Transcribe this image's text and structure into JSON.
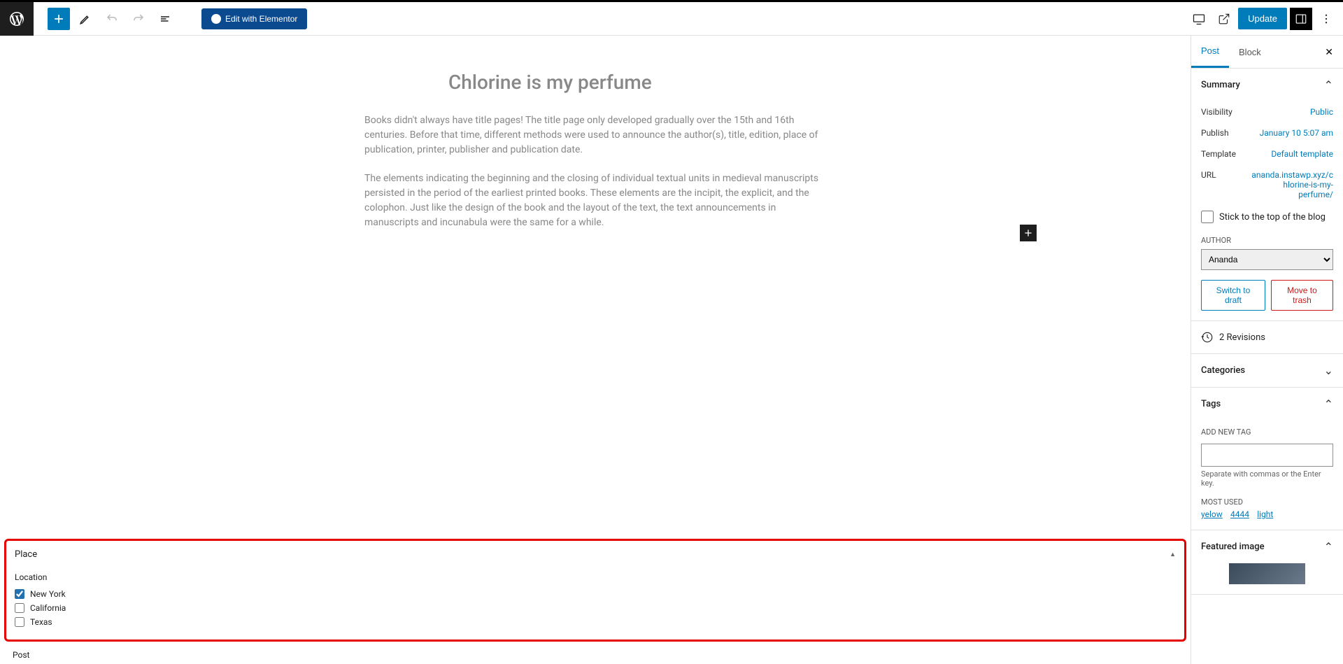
{
  "toolbar": {
    "elementor": "Edit with Elementor",
    "update": "Update"
  },
  "post": {
    "title": "Chlorine is my perfume",
    "p1": "Books didn't always have title pages! The title page only developed gradually over the 15th and 16th centuries. Before that time, different methods were used to announce the author(s), title, edition, place of publication, printer, publisher and publication date.",
    "p2": "The elements indicating the beginning and the closing of individual textual units in medieval manuscripts persisted in the period of the earliest printed books. These elements are the incipit, the explicit, and the colophon. Just like the design of the book and the layout of the text, the text announcements in manuscripts and incunabula were the same for a while."
  },
  "place": {
    "title": "Place",
    "location_label": "Location",
    "options": [
      "New York",
      "California",
      "Texas"
    ]
  },
  "footer": {
    "label": "Post"
  },
  "sidebar": {
    "tabs": {
      "post": "Post",
      "block": "Block"
    },
    "summary": {
      "title": "Summary",
      "visibility_label": "Visibility",
      "visibility_value": "Public",
      "publish_label": "Publish",
      "publish_value": "January 10 5:07 am",
      "template_label": "Template",
      "template_value": "Default template",
      "url_label": "URL",
      "url_value": "ananda.instawp.xyz/chlorine-is-my-perfume/",
      "stick": "Stick to the top of the blog",
      "author_label": "AUTHOR",
      "author_value": "Ananda",
      "draft": "Switch to draft",
      "trash": "Move to trash"
    },
    "revisions": "2 Revisions",
    "categories": "Categories",
    "tags": {
      "title": "Tags",
      "add_label": "ADD NEW TAG",
      "hint": "Separate with commas or the Enter key.",
      "most_used": "MOST USED",
      "links": [
        "yelow",
        "4444",
        "light"
      ]
    },
    "featured": "Featured image"
  }
}
